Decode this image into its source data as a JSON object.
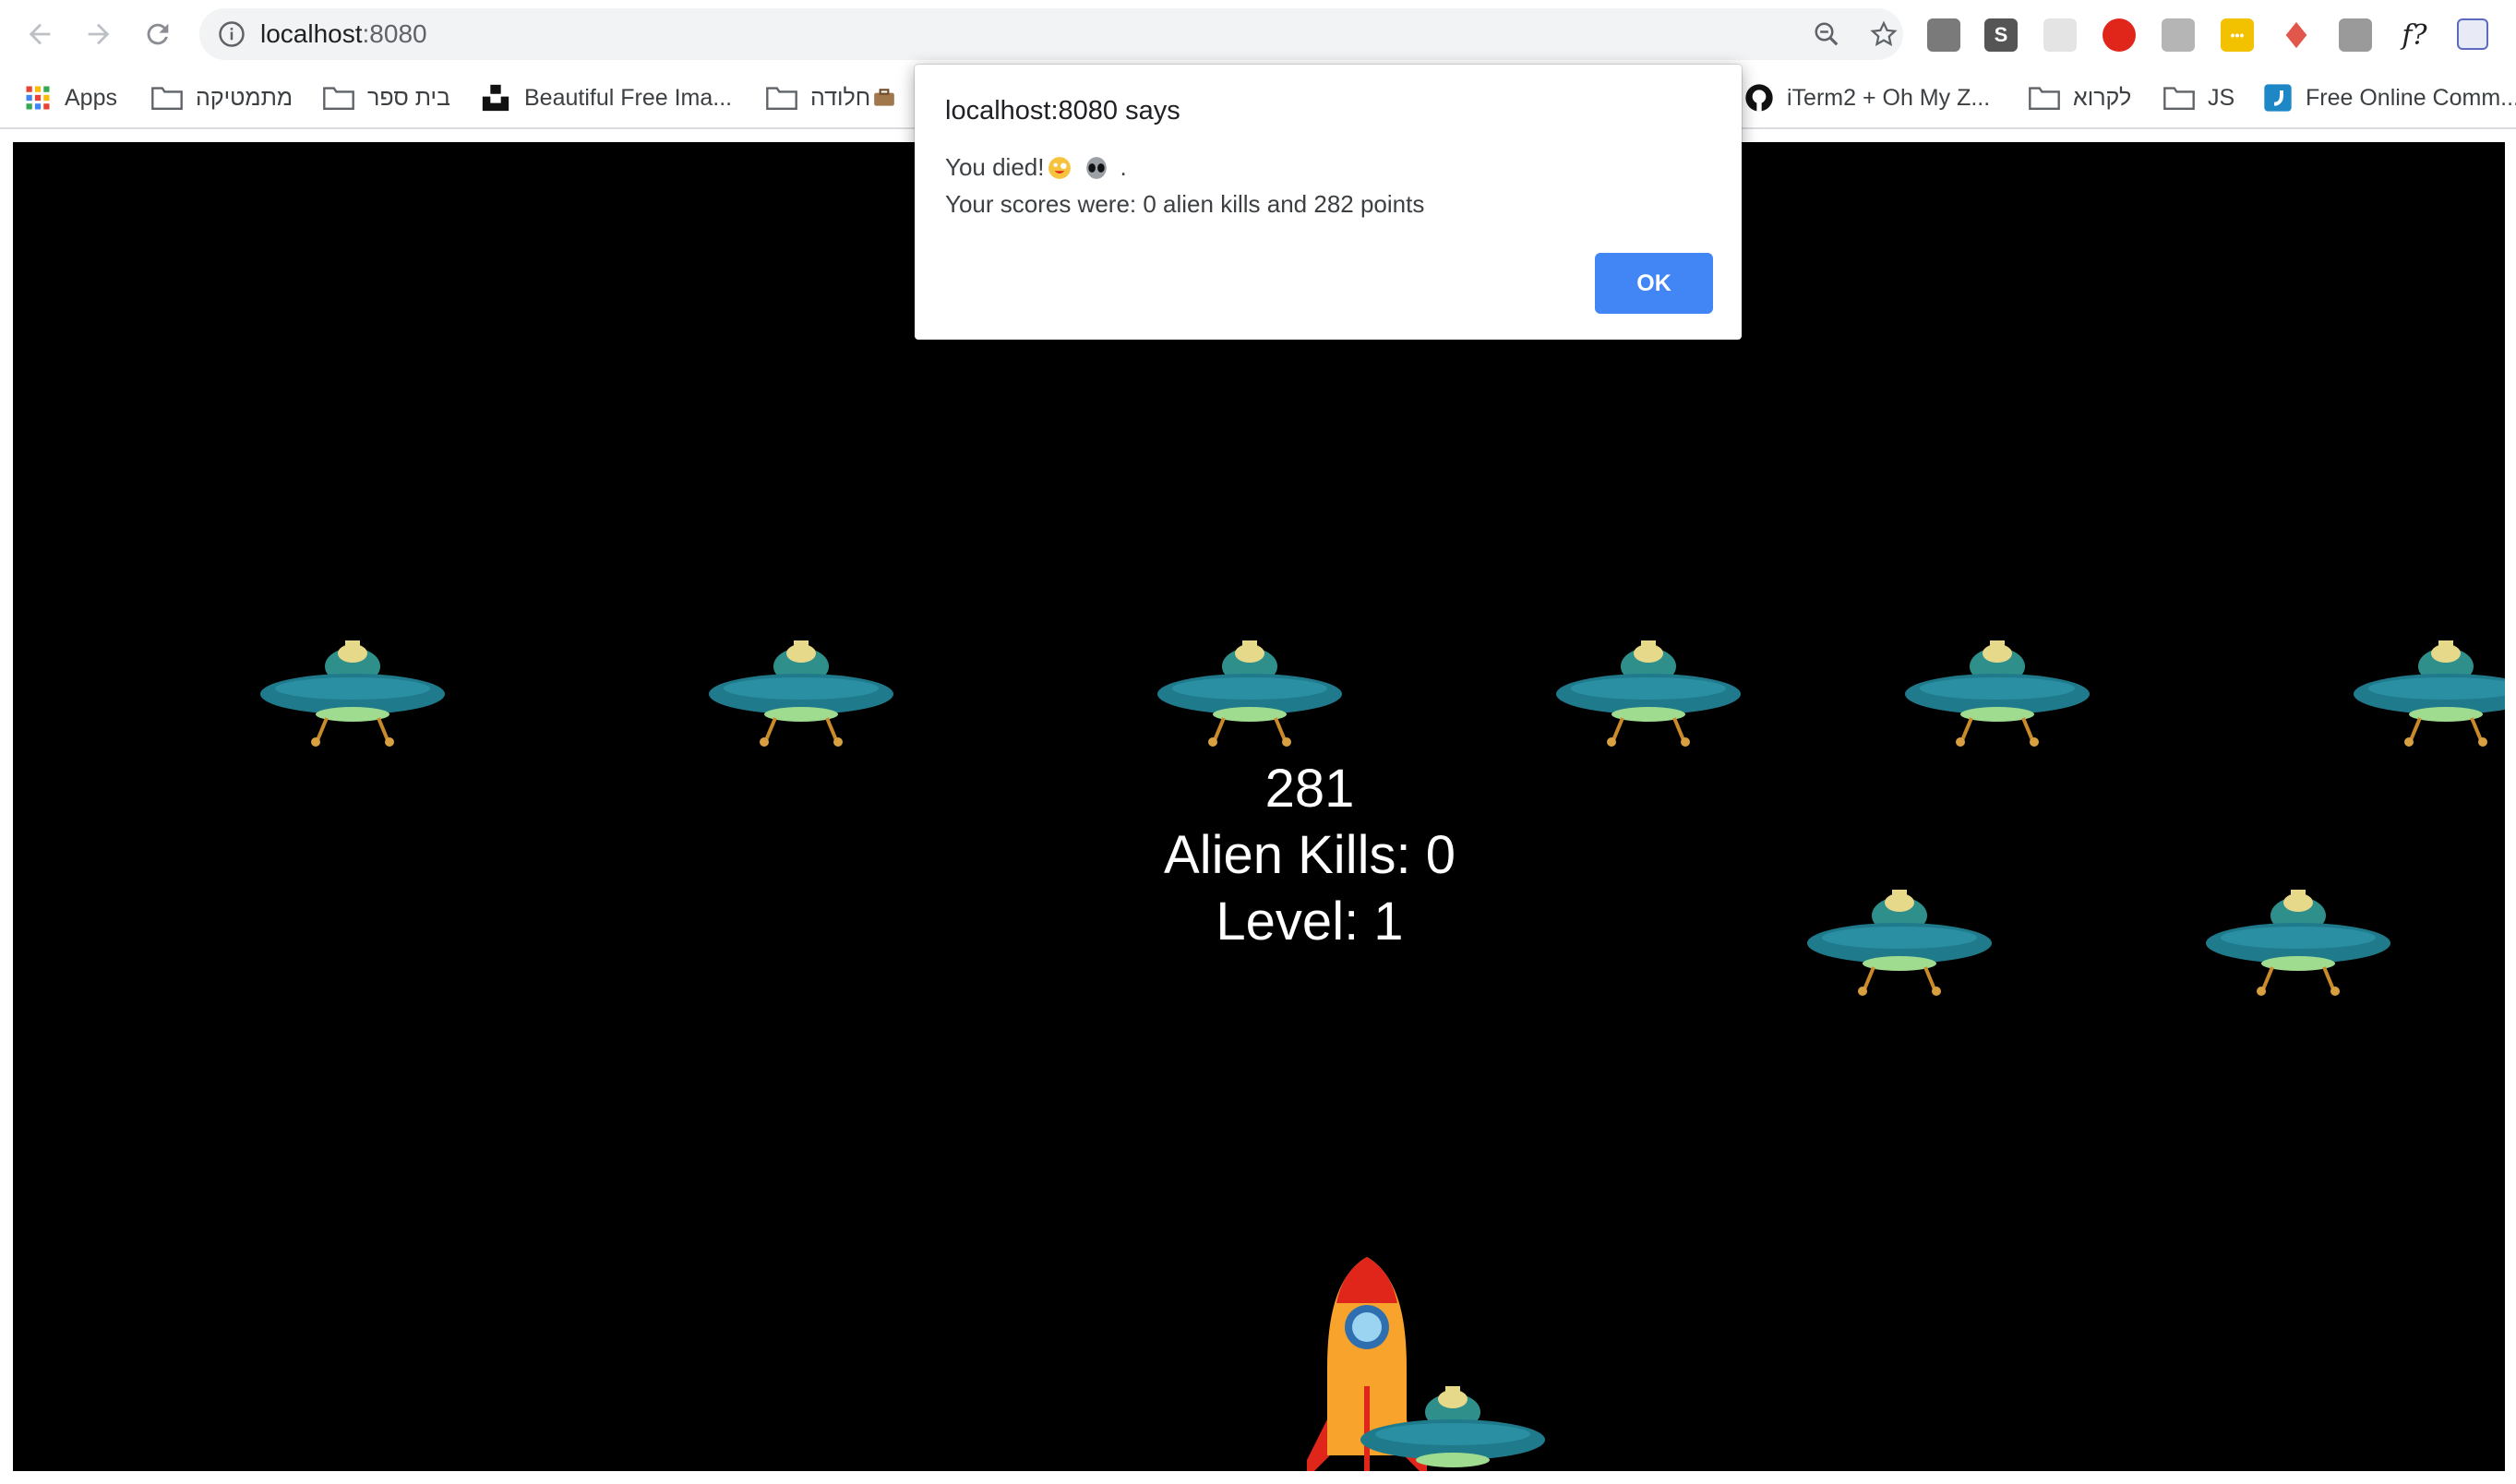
{
  "browser": {
    "url_host": "localhost",
    "url_port": ":8080",
    "extensions": [
      {
        "icon": "s-extension-icon",
        "label": "S",
        "color": "#555555"
      },
      {
        "icon": "ublock-extension-icon",
        "color": "#e0251b"
      },
      {
        "icon": "yellow-extension-icon",
        "label": "•••",
        "color": "#f2c200"
      },
      {
        "icon": "formula-extension-icon",
        "label": "f?"
      }
    ]
  },
  "bookmarks": {
    "apps": "Apps",
    "math": "מתמטיקה",
    "school": "בית ספר",
    "unsplash": "Beautiful Free Ima...",
    "holeda": "חלודה",
    "iterm": "iTerm2 + Oh My Z...",
    "reading": "לקרוא",
    "js": "JS",
    "free_online": "Free Online Comm..."
  },
  "game": {
    "score": "281",
    "alien_kills": "Alien Kills: 0",
    "level": "Level: 1"
  },
  "dialog": {
    "title": "localhost:8080 says",
    "message_prefix": "You died!",
    "message_suffix": ".",
    "scores_line": "Your scores were: 0 alien kills and 282 points",
    "ok_label": "OK"
  },
  "colors": {
    "accent": "#4285f4",
    "game_background": "#000000",
    "ufo_body": "#1f7a8c",
    "ufo_dome": "#e6d98a",
    "rocket": "#f8a32b"
  }
}
